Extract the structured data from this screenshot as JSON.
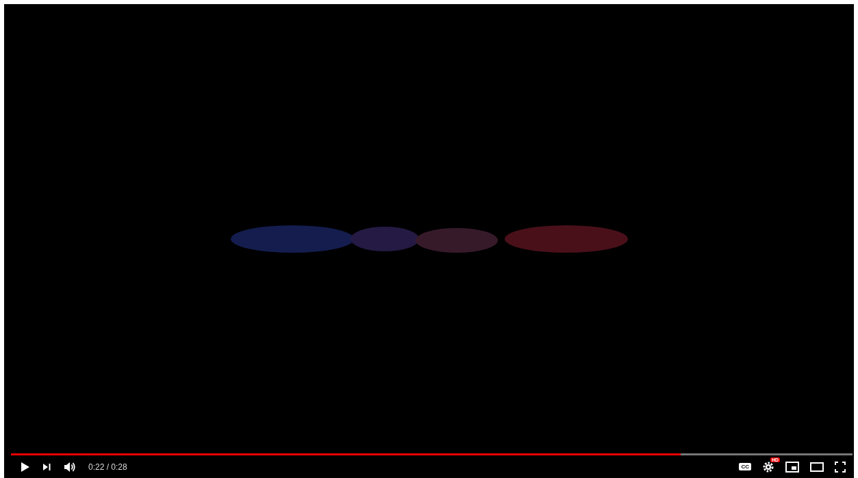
{
  "player": {
    "progress": {
      "level": 0.796
    },
    "playing": false,
    "time": "0:22 / 0:28",
    "captions": {
      "label": "CC"
    },
    "settings": {
      "badge": "HD"
    }
  }
}
